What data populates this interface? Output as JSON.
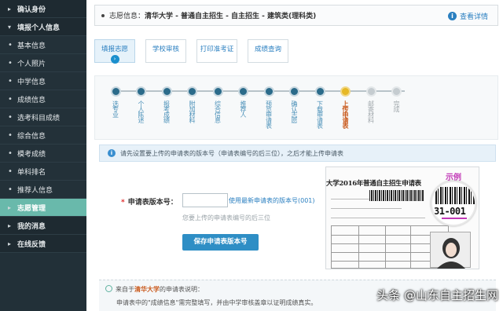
{
  "sidebar": {
    "items": [
      {
        "label": "确认身份",
        "type": "head",
        "mark": "▸"
      },
      {
        "label": "填报个人信息",
        "type": "head",
        "mark": "▾"
      },
      {
        "label": "基本信息",
        "type": "sub",
        "mark": "•"
      },
      {
        "label": "个人照片",
        "type": "sub",
        "mark": "•"
      },
      {
        "label": "中学信息",
        "type": "sub",
        "mark": "•"
      },
      {
        "label": "成绩信息",
        "type": "sub",
        "mark": "•"
      },
      {
        "label": "选考科目成绩",
        "type": "sub",
        "mark": "•"
      },
      {
        "label": "综合信息",
        "type": "sub",
        "mark": "•"
      },
      {
        "label": "模考成绩",
        "type": "sub",
        "mark": "•"
      },
      {
        "label": "单科排名",
        "type": "sub",
        "mark": "•"
      },
      {
        "label": "推荐人信息",
        "type": "sub",
        "mark": "•"
      },
      {
        "label": "志愿管理",
        "type": "active",
        "mark": "▸"
      },
      {
        "label": "我的消息",
        "type": "head",
        "mark": "▸"
      },
      {
        "label": "在线反馈",
        "type": "head",
        "mark": "▸"
      }
    ]
  },
  "infobar": {
    "label": "志愿信息：",
    "value": "清华大学 - 普通自主招生 - 自主招生 - 建筑类(理科类)",
    "detail_link": "查看详情",
    "detail_icon": "i"
  },
  "tabs": [
    {
      "label": "填报志愿",
      "active": true
    },
    {
      "label": "学校审核",
      "active": false
    },
    {
      "label": "打印准考证",
      "active": false
    },
    {
      "label": "成绩查询",
      "active": false
    }
  ],
  "steps": [
    {
      "label": "选专业",
      "state": "done"
    },
    {
      "label": "个人陈述",
      "state": "done"
    },
    {
      "label": "报考成绩",
      "state": "done"
    },
    {
      "label": "附加材料",
      "state": "done"
    },
    {
      "label": "综合信息",
      "state": "done"
    },
    {
      "label": "推荐人",
      "state": "done"
    },
    {
      "label": "预览申请表",
      "state": "done"
    },
    {
      "label": "确认志愿",
      "state": "done"
    },
    {
      "label": "下载申请表",
      "state": "done"
    },
    {
      "label": "上传申请表",
      "state": "current"
    },
    {
      "label": "邮寄材料",
      "state": "future"
    },
    {
      "label": "完成",
      "state": "future"
    }
  ],
  "notice": {
    "icon": "i",
    "text": "请先设置要上传的申请表的版本号（申请表编号的后三位），之后才能上传申请表"
  },
  "form": {
    "required_mark": "*",
    "label": "申请表版本号：",
    "input_value": "",
    "use_latest_link": "使用最新申请表的版本号(001)",
    "hint": "您要上传的申请表编号的后三位",
    "save_button": "保存申请表版本号"
  },
  "sample": {
    "title": "大学2016年普通自主招生申请表",
    "tag": "示例",
    "code": "31-001"
  },
  "note": {
    "prefix": "来自于",
    "university": "清华大学",
    "suffix": "的申请表说明：",
    "line2": "申请表中的\"成绩信息\"需完整填写，并由中学审核盖章以证明成绩真实。"
  },
  "watermark": "头条 @山东自主招生网"
}
